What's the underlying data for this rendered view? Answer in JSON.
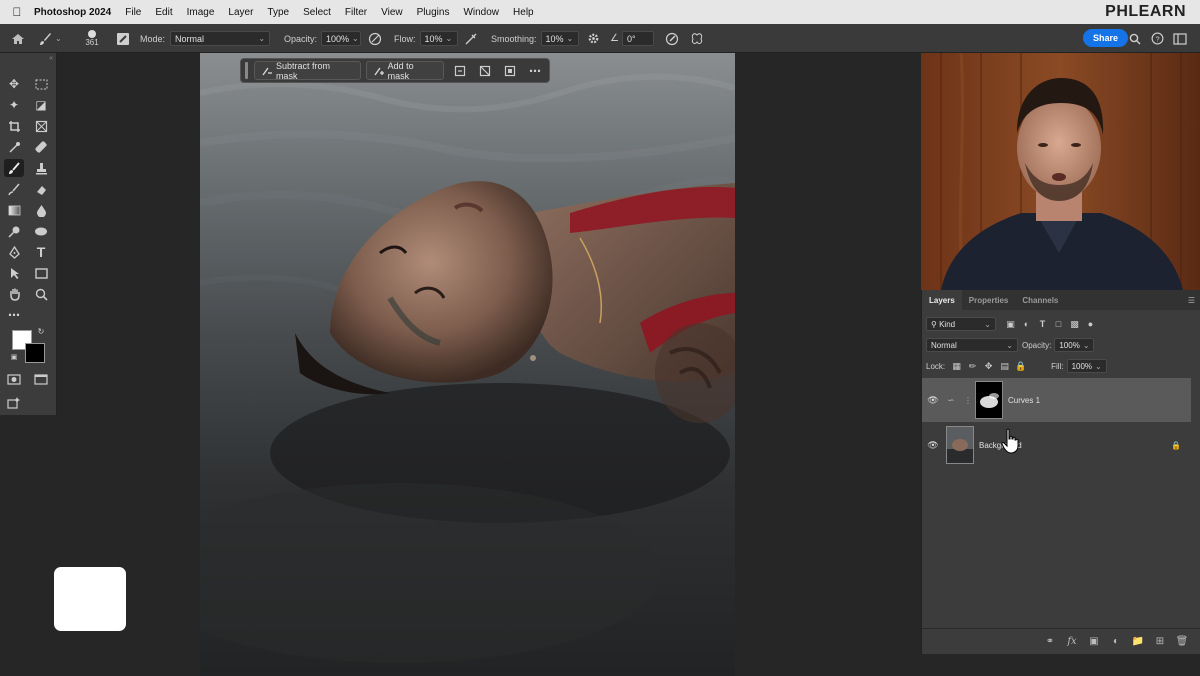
{
  "menubar": {
    "app_name": "Photoshop 2024",
    "items": [
      "File",
      "Edit",
      "Image",
      "Layer",
      "Type",
      "Select",
      "Filter",
      "View",
      "Plugins",
      "Window",
      "Help"
    ],
    "brand": "PHLEARN"
  },
  "options_bar": {
    "brush_size": "361",
    "mode_label": "Mode:",
    "mode_value": "Normal",
    "opacity_label": "Opacity:",
    "opacity_value": "100%",
    "flow_label": "Flow:",
    "flow_value": "10%",
    "smoothing_label": "Smoothing:",
    "smoothing_value": "10%",
    "angle_value": "0°",
    "share_label": "Share"
  },
  "context_bar": {
    "subtract_label": "Subtract from mask",
    "add_label": "Add to mask"
  },
  "layers_panel": {
    "tabs": [
      "Layers",
      "Properties",
      "Channels"
    ],
    "filter_kind": "Kind",
    "blend_mode": "Normal",
    "opacity_label": "Opacity:",
    "opacity_value": "100%",
    "lock_label": "Lock:",
    "fill_label": "Fill:",
    "fill_value": "100%",
    "layers": [
      {
        "name": "Curves 1"
      },
      {
        "name": "Background"
      }
    ]
  },
  "colors": {
    "accent": "#1473e6",
    "foreground_swatch": "#ffffff",
    "background_swatch": "#000000"
  },
  "icons": {
    "home": "home-icon",
    "brush": "brush-icon",
    "move": "move-icon",
    "search": "search-icon",
    "help": "help-icon",
    "eye": "eye-icon",
    "lock": "lock-icon",
    "trash": "trash-icon"
  }
}
